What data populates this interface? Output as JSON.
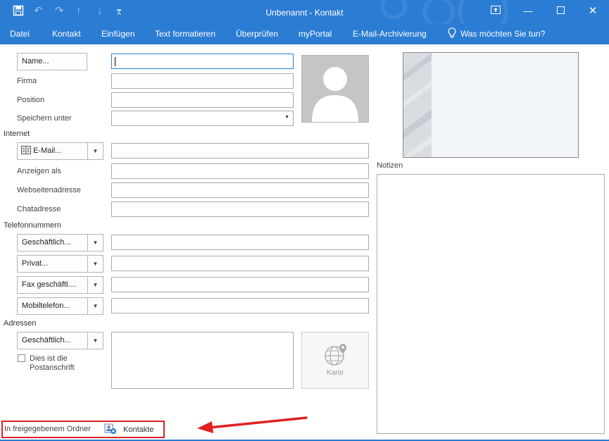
{
  "window": {
    "title": "Unbenannt - Kontakt",
    "quick_access": {
      "save": "save-icon",
      "undo": "undo-icon",
      "redo": "redo-icon",
      "up": "arrow-up-icon",
      "down": "arrow-down-icon",
      "customize": "customize-icon"
    },
    "controls": {
      "ribbon_display": "ribbon-display-icon",
      "minimize": "minimize-icon",
      "maximize": "maximize-icon",
      "close": "close-icon"
    }
  },
  "menu": {
    "items": [
      "Datei",
      "Kontakt",
      "Einfügen",
      "Text formatieren",
      "Überprüfen",
      "myPortal",
      "E-Mail-Archivierung"
    ],
    "tell_me": "Was möchten Sie tun?"
  },
  "form": {
    "name_button": "Name...",
    "labels": {
      "firma": "Firma",
      "position": "Position",
      "speichern_unter": "Speichern unter",
      "anzeigen_als": "Anzeigen als",
      "webseitenadresse": "Webseitenadresse",
      "chatadresse": "Chatadresse"
    },
    "sections": {
      "internet": "Internet",
      "telefon": "Telefonnummern",
      "adressen": "Adressen"
    },
    "email_button": "E-Mail...",
    "phone_buttons": [
      "Geschäftlich...",
      "Privat...",
      "Fax geschäftl....",
      "Mobiltelefon..."
    ],
    "address_button": "Geschäftlich...",
    "postal_checkbox": {
      "line1": "Dies ist die",
      "line2": "Postanschrift",
      "checked": false
    },
    "map_button": "Karte",
    "notes_label": "Notizen"
  },
  "footer": {
    "label": "In freigegebenem Ordner",
    "folder": "Kontakte"
  },
  "colors": {
    "accent": "#2b7cd3",
    "highlight": "#e02020"
  }
}
